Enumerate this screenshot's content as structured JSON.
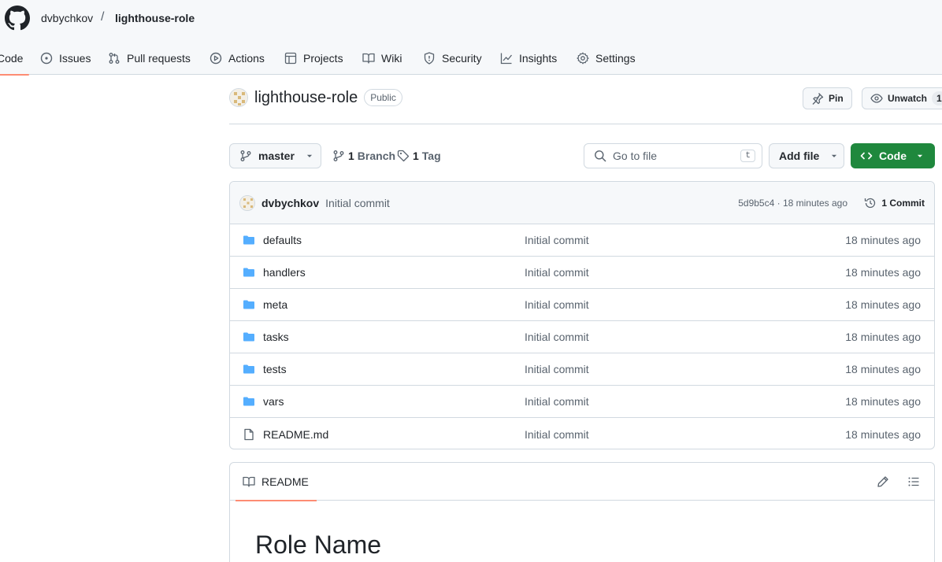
{
  "header": {
    "owner": "dvbychkov",
    "separator": "/",
    "repo": "lighthouse-role"
  },
  "tabs": [
    {
      "label": "Code",
      "icon": "code-icon",
      "active": true
    },
    {
      "label": "Issues",
      "icon": "issue-opened-icon"
    },
    {
      "label": "Pull requests",
      "icon": "git-pull-request-icon"
    },
    {
      "label": "Actions",
      "icon": "play-icon"
    },
    {
      "label": "Projects",
      "icon": "table-icon"
    },
    {
      "label": "Wiki",
      "icon": "book-icon"
    },
    {
      "label": "Security",
      "icon": "shield-icon"
    },
    {
      "label": "Insights",
      "icon": "graph-icon"
    },
    {
      "label": "Settings",
      "icon": "gear-icon"
    }
  ],
  "repo": {
    "name": "lighthouse-role",
    "visibility": "Public",
    "pin_label": "Pin",
    "unwatch_label": "Unwatch",
    "watch_count": "1"
  },
  "toolbar": {
    "branch": "master",
    "branch_count": "1",
    "branch_label": "Branch",
    "tag_count": "1",
    "tag_label": "Tag",
    "search_placeholder": "Go to file",
    "search_kbd": "t",
    "add_file_label": "Add file",
    "code_label": "Code"
  },
  "commit": {
    "author": "dvbychkov",
    "message": "Initial commit",
    "meta": "5d9b5c4 · 18 minutes ago",
    "count_label": "1 Commit"
  },
  "files": [
    {
      "name": "defaults",
      "type": "folder",
      "message": "Initial commit",
      "time": "18 minutes ago"
    },
    {
      "name": "handlers",
      "type": "folder",
      "message": "Initial commit",
      "time": "18 minutes ago"
    },
    {
      "name": "meta",
      "type": "folder",
      "message": "Initial commit",
      "time": "18 minutes ago"
    },
    {
      "name": "tasks",
      "type": "folder",
      "message": "Initial commit",
      "time": "18 minutes ago"
    },
    {
      "name": "tests",
      "type": "folder",
      "message": "Initial commit",
      "time": "18 minutes ago"
    },
    {
      "name": "vars",
      "type": "folder",
      "message": "Initial commit",
      "time": "18 minutes ago"
    },
    {
      "name": "README.md",
      "type": "file",
      "message": "Initial commit",
      "time": "18 minutes ago"
    }
  ],
  "readme": {
    "tab_label": "README",
    "heading": "Role Name"
  },
  "colors": {
    "accent": "#fd8c73",
    "primary_button": "#1f883d",
    "folder": "#54aeff"
  }
}
